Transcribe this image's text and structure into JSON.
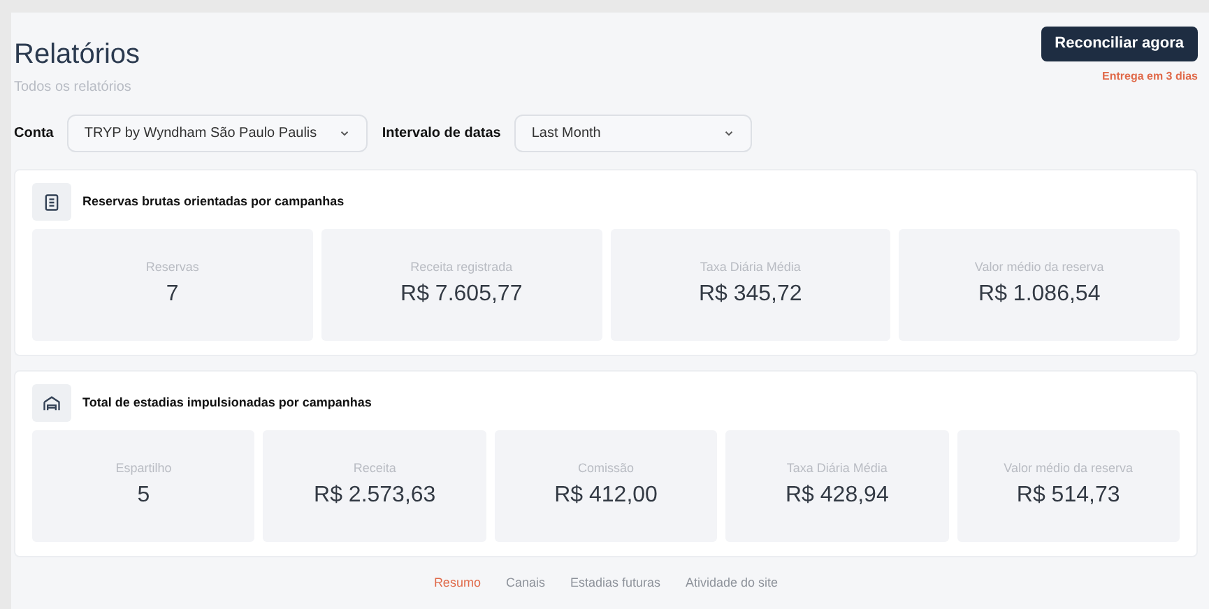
{
  "header": {
    "title": "Relatórios",
    "subtitle": "Todos os relatórios",
    "button": "Reconciliar agora",
    "note": "Entrega em 3 dias"
  },
  "filters": [
    {
      "label": "Conta",
      "value": "TRYP by Wyndham São Paulo Paulis"
    },
    {
      "label": "Intervalo de datas",
      "value": "Last Month"
    }
  ],
  "sections": [
    {
      "kind": "list",
      "title": "Reservas brutas orientadas por campanhas",
      "stats": [
        {
          "label": "Reservas",
          "value": "7"
        },
        {
          "label": "Receita registrada",
          "value": "R$ 7.605,77"
        },
        {
          "label": "Taxa Diária Média",
          "value": "R$ 345,72"
        },
        {
          "label": "Valor médio da reserva",
          "value": "R$ 1.086,54"
        }
      ]
    },
    {
      "kind": "bed",
      "title": "Total de estadias impulsionadas por campanhas",
      "stats": [
        {
          "label": "Espartilho",
          "value": "5"
        },
        {
          "label": "Receita",
          "value": "R$ 2.573,63"
        },
        {
          "label": "Comissão",
          "value": "R$ 412,00"
        },
        {
          "label": "Taxa Diária Média",
          "value": "R$ 428,94"
        },
        {
          "label": "Valor médio da reserva",
          "value": "R$ 514,73"
        }
      ]
    }
  ],
  "tabs": [
    {
      "label": "Resumo",
      "selected": true
    },
    {
      "label": "Canais",
      "selected": false
    },
    {
      "label": "Estadias futuras",
      "selected": false
    },
    {
      "label": "Atividade do site",
      "selected": false
    }
  ]
}
